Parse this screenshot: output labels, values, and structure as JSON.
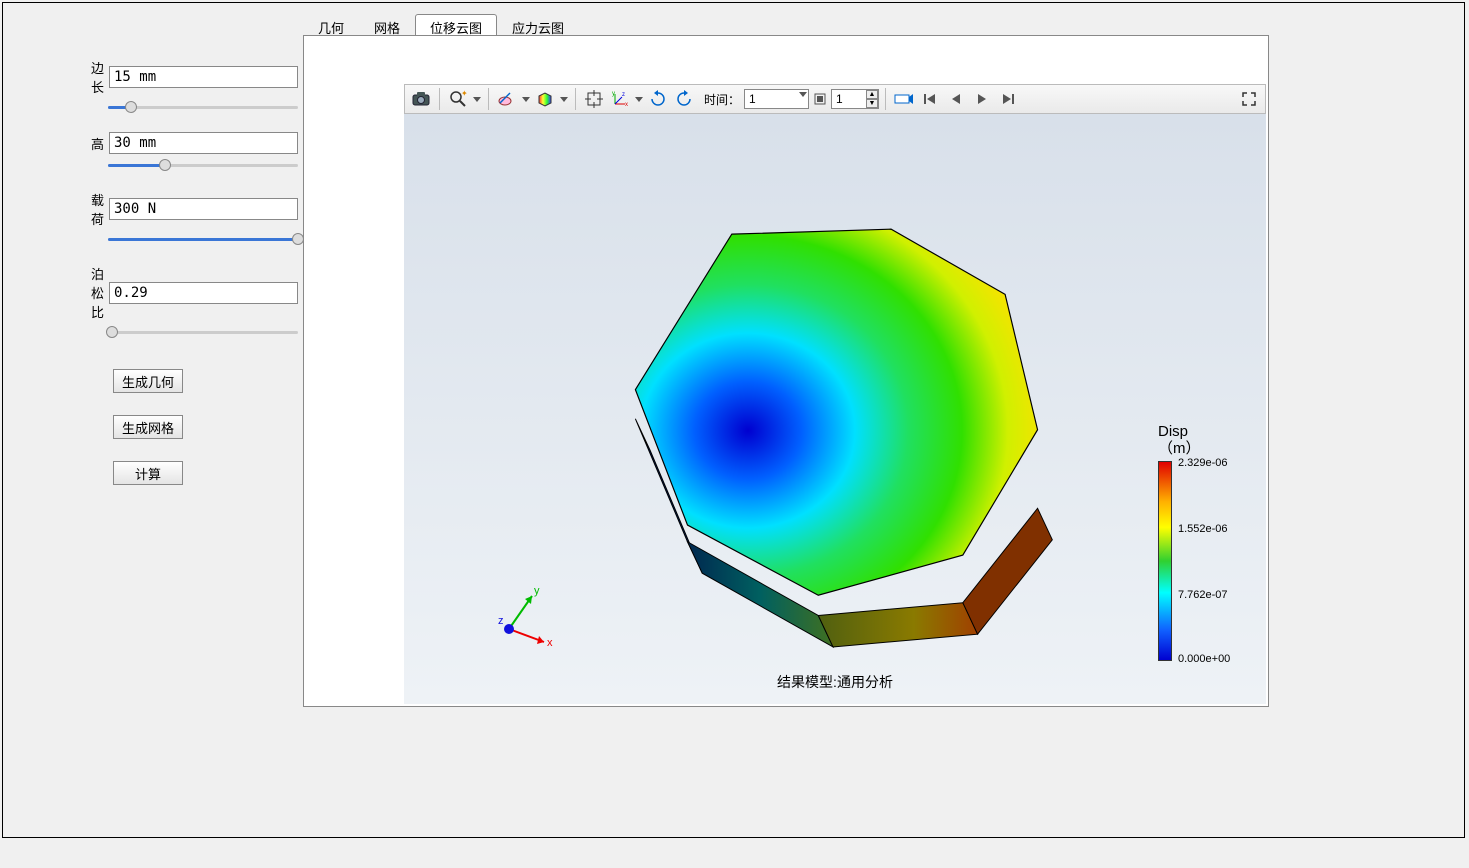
{
  "params": {
    "sidelen": {
      "label": "边长",
      "value": "15 mm",
      "fill": 12
    },
    "height": {
      "label": "高",
      "value": "30 mm",
      "fill": 30
    },
    "load": {
      "label": "载荷",
      "value": "300 N",
      "fill": 100
    },
    "poisson": {
      "label": "泊松比",
      "value": "0.29",
      "fill": 2
    }
  },
  "buttons": {
    "gen_geom": "生成几何",
    "gen_mesh": "生成网格",
    "compute": "计算"
  },
  "tabs": {
    "geom": "几何",
    "mesh": "网格",
    "disp": "位移云图",
    "stress": "应力云图",
    "active": "disp"
  },
  "toolbar": {
    "time_label": "时间：",
    "time_value": "1",
    "frame_value": "1"
  },
  "viewport": {
    "footer": "结果模型:通用分析",
    "axes": {
      "x": "x",
      "y": "y",
      "z": "z"
    }
  },
  "legend": {
    "title1": "Disp",
    "title2": "（m）",
    "v0": "2.329e-06",
    "v1": "1.552e-06",
    "v2": "7.762e-07",
    "v3": "0.000e+00"
  }
}
